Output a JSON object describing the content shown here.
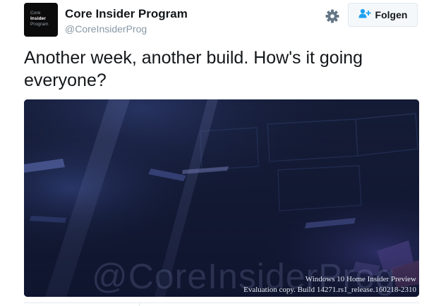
{
  "author": {
    "avatar_lines": [
      "Core",
      "Insider",
      "Program"
    ],
    "display_name": "Core Insider Program",
    "handle": "@CoreInsiderProg"
  },
  "actions": {
    "settings_icon": "gear-icon",
    "follow_icon": "add-user-icon",
    "follow_label": "Folgen"
  },
  "tweet": {
    "text": "Another week, another build. How's it going everyone?"
  },
  "media": {
    "watermark": "@CoreInsiderProg",
    "build_edition": "Windows 10 Home Insider Preview",
    "build_info": "Evaluation copy. Build 14271.rs1_release.160218-2310"
  },
  "colors": {
    "text": "#14171a",
    "secondary_text": "#8899a6",
    "button_bg": "#f5f8fa",
    "button_icon": "#1da1f2",
    "wallpaper": "#141b33"
  }
}
